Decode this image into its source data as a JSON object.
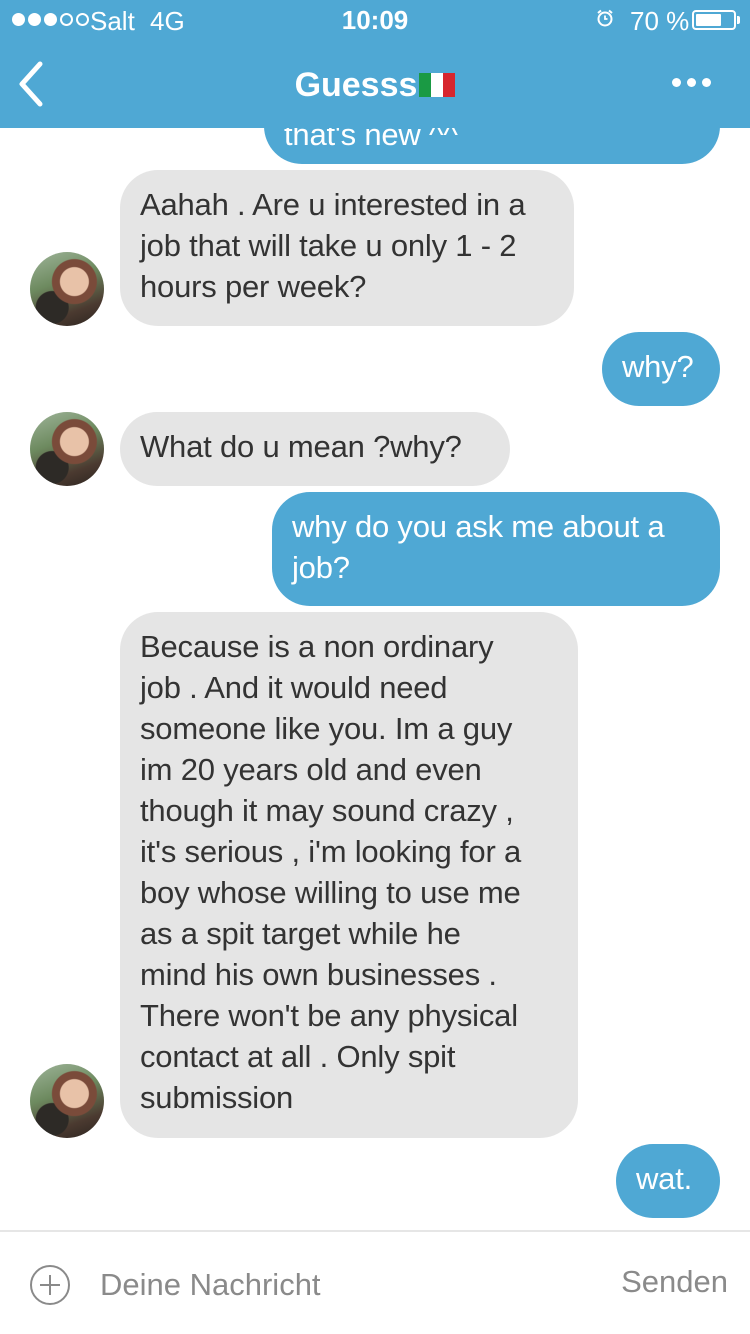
{
  "status_bar": {
    "carrier": "Salt",
    "network": "4G",
    "time": "10:09",
    "battery_percent_text": "70 %",
    "battery_level": 0.7,
    "signal_bars": 3,
    "signal_total": 5
  },
  "header": {
    "title": "Guesss",
    "flag": "italy-flag",
    "back_icon": "chevron-left-icon",
    "more_icon": "more-horizontal-icon"
  },
  "messages": [
    {
      "from": "me",
      "text": "that's new ^^"
    },
    {
      "from": "them",
      "text": "Aahah . Are u interested in a\njob that will take u only 1 - 2\nhours per week?"
    },
    {
      "from": "me",
      "text": "why?"
    },
    {
      "from": "them",
      "text": "What do u mean ?why?"
    },
    {
      "from": "me",
      "text": "why do you ask me about a\njob?"
    },
    {
      "from": "them",
      "text": "Because is a non ordinary\njob . And it would need\nsomeone like you. Im a guy\nim 20 years old and even\nthough it may sound crazy ,\nit's serious , i'm looking for a\nboy whose willing to use me\nas a spit target while he\nmind his own businesses .\nThere won't be any physical\ncontact at all . Only spit\nsubmission"
    },
    {
      "from": "me",
      "text": "wat."
    }
  ],
  "input": {
    "placeholder": "Deine Nachricht",
    "value": "",
    "send_label": "Senden"
  },
  "colors": {
    "accent": "#4fa8d4",
    "incoming_bubble": "#e5e5e5",
    "incoming_text": "#333333"
  }
}
